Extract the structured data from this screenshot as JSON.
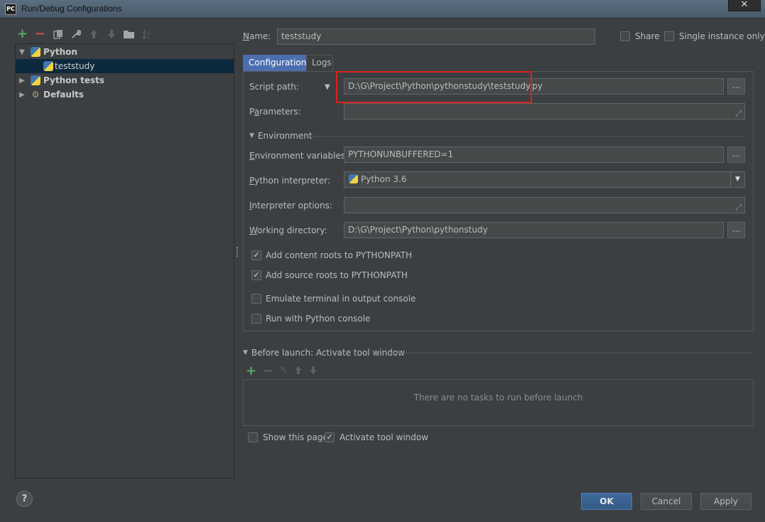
{
  "window": {
    "title": "Run/Debug Configurations",
    "app_icon_text": "PC",
    "close_glyph": "✕"
  },
  "left_toolbar": {
    "icons": [
      "add-icon",
      "remove-icon",
      "copy-icon",
      "edit-defaults-icon",
      "move-up-icon",
      "move-down-icon",
      "folder-icon",
      "sort-icon"
    ]
  },
  "tree": {
    "items": [
      {
        "label": "Python",
        "expanded": true,
        "bold": true
      },
      {
        "label": "teststudy",
        "selected": true
      },
      {
        "label": "Python tests",
        "expanded": false,
        "bold": true
      },
      {
        "label": "Defaults",
        "expanded": false,
        "bold": true
      }
    ]
  },
  "header": {
    "name_label": "Name:",
    "name_value": "teststudy",
    "share_label": "Share",
    "share_checked": false,
    "single_instance_label": "Single instance only",
    "single_instance_checked": false
  },
  "tabs": [
    {
      "label": "Configuration",
      "active": true
    },
    {
      "label": "Logs",
      "active": false
    }
  ],
  "config": {
    "script_path_label": "Script path:",
    "script_path_value": "D:\\G\\Project\\Python\\pythonstudy\\teststudy.py",
    "parameters_label": "Parameters:",
    "parameters_value": "",
    "environment_section": "Environment",
    "env_vars_label": "Environment variables:",
    "env_vars_value": "PYTHONUNBUFFERED=1",
    "interpreter_label": "Python interpreter:",
    "interpreter_value": "Python 3.6",
    "interpreter_options_label": "Interpreter options:",
    "interpreter_options_value": "",
    "working_dir_label": "Working directory:",
    "working_dir_value": "D:\\G\\Project\\Python\\pythonstudy",
    "browse_glyph": "...",
    "checkboxes": [
      {
        "label": "Add content roots to PYTHONPATH",
        "checked": true
      },
      {
        "label": "Add source roots to PYTHONPATH",
        "checked": true
      },
      {
        "label": "Emulate terminal in output console",
        "checked": false
      },
      {
        "label": "Run with Python console",
        "checked": false
      }
    ]
  },
  "before_launch": {
    "title": "Before launch: Activate tool window",
    "empty_message": "There are no tasks to run before launch",
    "show_page_label": "Show this page",
    "show_page_checked": false,
    "activate_label": "Activate tool window",
    "activate_checked": true
  },
  "buttons": {
    "ok": "OK",
    "cancel": "Cancel",
    "apply": "Apply",
    "help": "?"
  },
  "colors": {
    "background": "#3c3f41",
    "selection": "#0d293e",
    "active_tab": "#4b6eaf",
    "highlight_box": "#e0201b",
    "add_green": "#59a869",
    "remove_red": "#c75450"
  }
}
